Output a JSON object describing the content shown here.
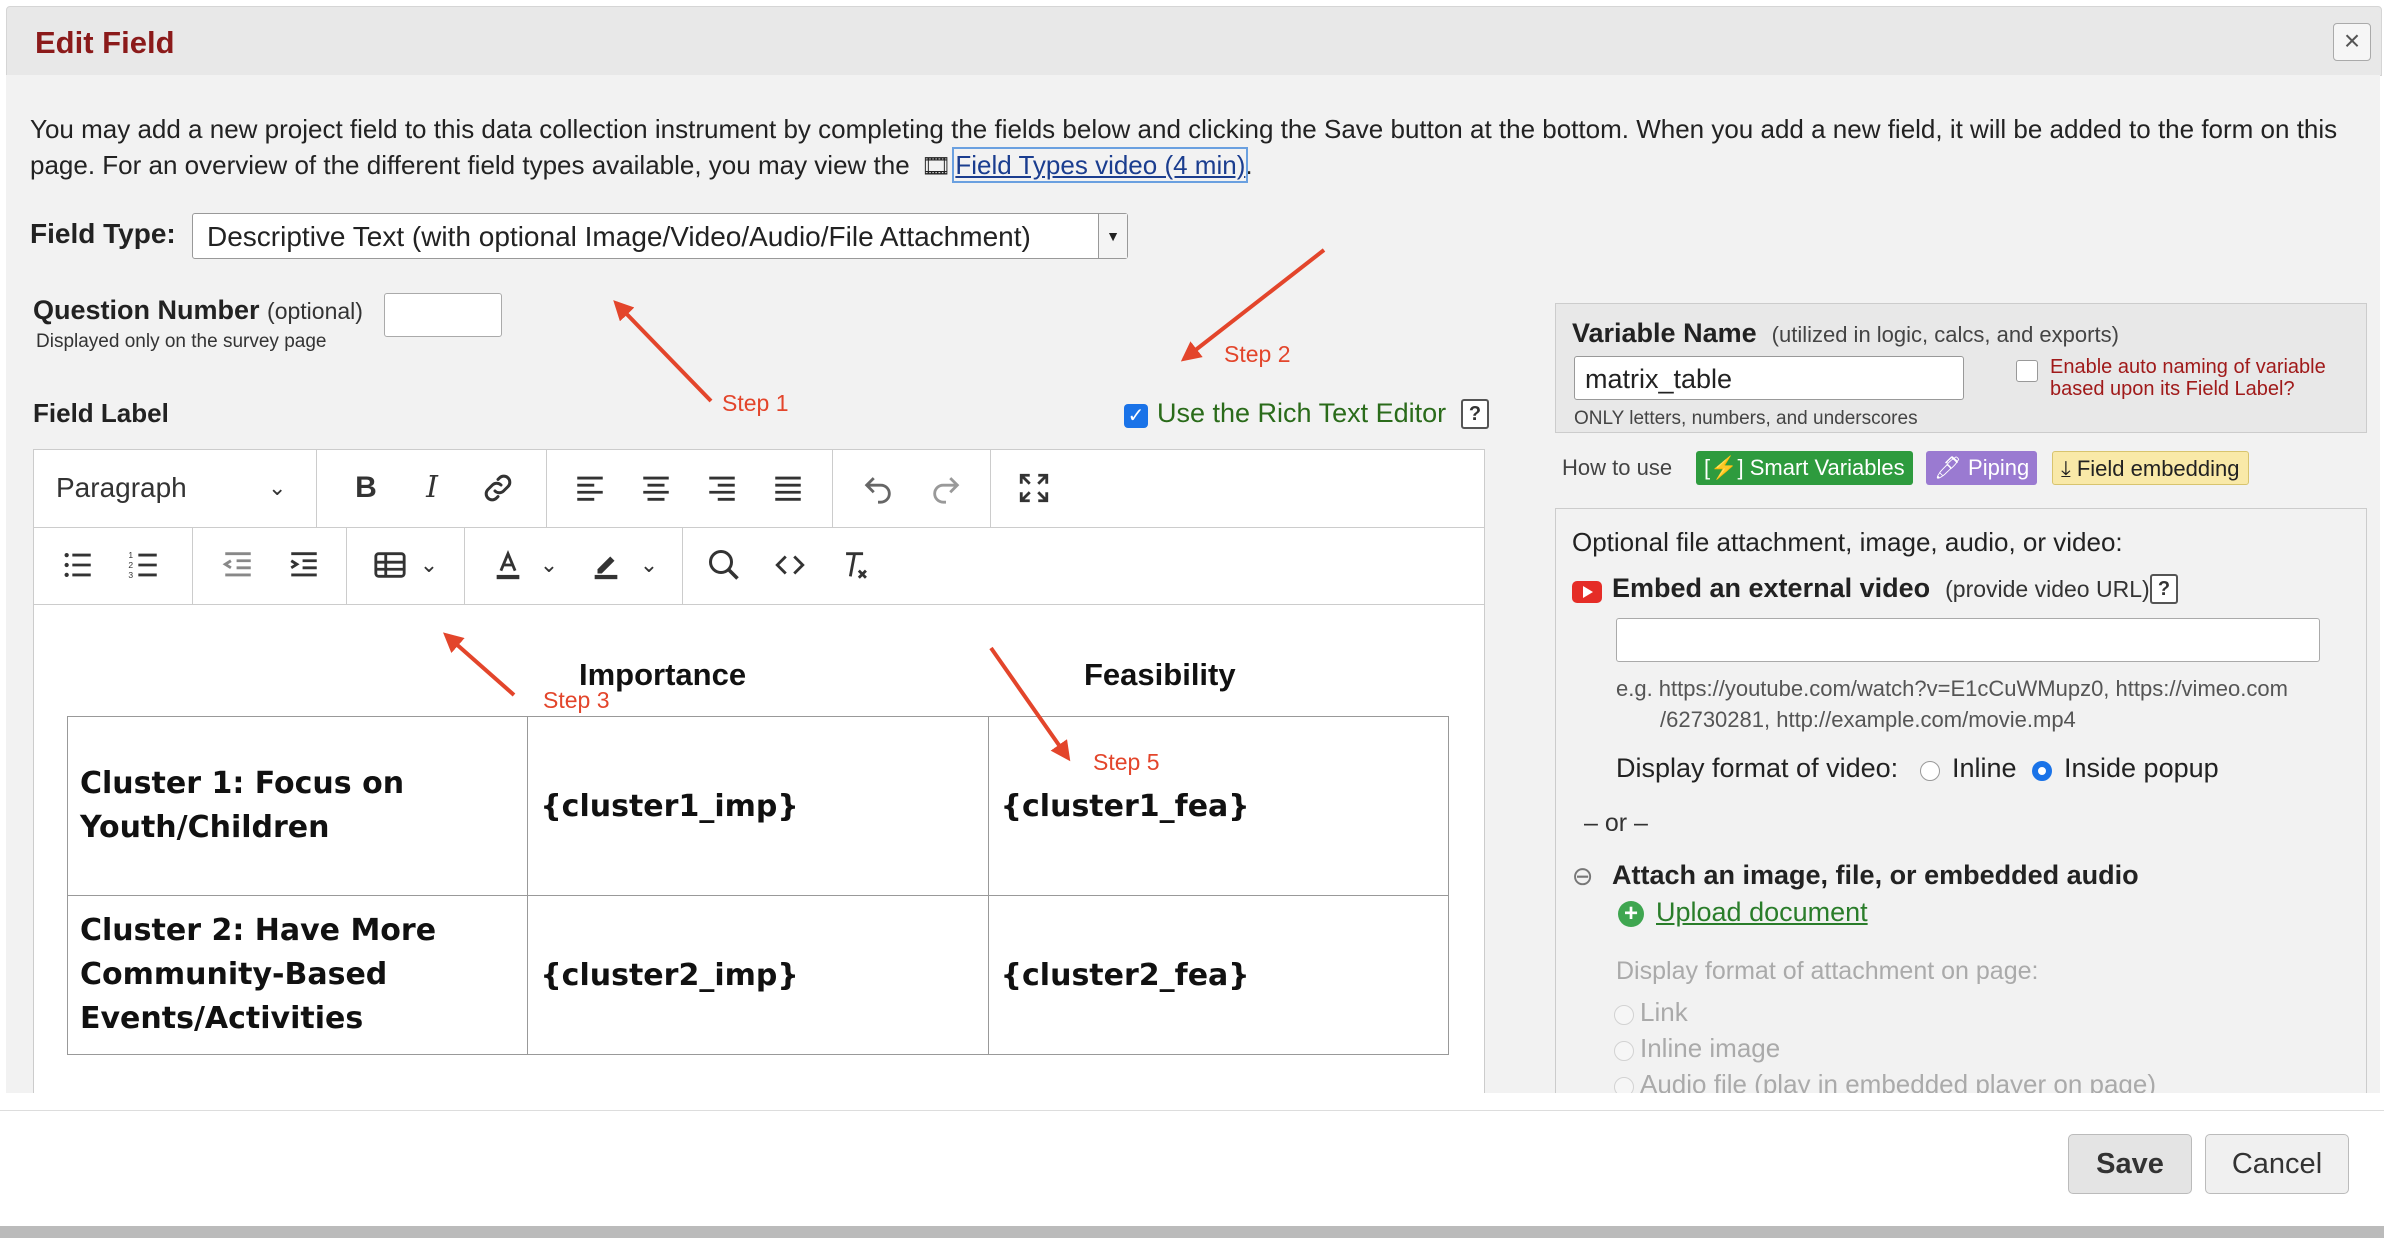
{
  "dialog": {
    "title": "Edit Field",
    "close_glyph": "×"
  },
  "intro": {
    "text": "You may add a new project field to this data collection instrument by completing the fields below and clicking the Save button at the bottom. When you add a new field, it will be added to the form on this page. For an overview of the different field types available, you may view the",
    "film_glyph": "🎞",
    "link": "Field Types video (4 min)",
    "after_link": "."
  },
  "field_type": {
    "label": "Field Type:",
    "value": "Descriptive Text (with optional Image/Video/Audio/File Attachment)"
  },
  "question_number": {
    "label": "Question Number",
    "optional": "(optional)",
    "sub": "Displayed only on the survey page"
  },
  "field_label": {
    "label": "Field Label",
    "rte_label": "Use the Rich Text Editor",
    "help": "?"
  },
  "toolbar": {
    "block_format": "Paragraph"
  },
  "matrix": {
    "col_headers": [
      "Importance",
      "Feasibility"
    ],
    "rows": [
      {
        "label": "Cluster 1: Focus on Youth/Children",
        "imp": "{cluster1_imp}",
        "fea": "{cluster1_fea}"
      },
      {
        "label_bold": "Cluster 2:",
        "label_rest": " Have More Community-Based Events/Activities",
        "imp": "{cluster2_imp}",
        "fea": "{cluster2_fea}"
      }
    ]
  },
  "annotations": {
    "step1": "Step 1",
    "step2": "Step 2",
    "step3": "Step 3",
    "step5": "Step 5",
    "color": "#e3452b"
  },
  "variable": {
    "label": "Variable Name",
    "hint": "(utilized in logic, calcs, and exports)",
    "value": "matrix_table",
    "sub": "ONLY letters, numbers, and underscores",
    "auto_label": "Enable auto naming of variable based upon its Field Label?"
  },
  "howto": {
    "label": "How to use",
    "smart": "[⚡] Smart Variables",
    "piping": "🖊 Piping",
    "embedding": "⤓ Field embedding"
  },
  "attachment": {
    "heading": "Optional file attachment, image, audio, or video:",
    "embed_label": "Embed an external video",
    "embed_hint": "(provide video URL)",
    "help": "?",
    "eg_line1": "e.g. https://youtube.com/watch?v=E1cCuWMupz0, https://vimeo.com",
    "eg_line2": "/62730281, http://example.com/movie.mp4",
    "display_label": "Display format of video:",
    "opt_inline": "Inline",
    "opt_popup": "Inside popup",
    "or": "– or –",
    "attach_label": "Attach an image, file, or embedded audio",
    "upload": "Upload document",
    "fmt_label": "Display format of attachment on page:",
    "fmt_link": "Link",
    "fmt_inline_img": "Inline image",
    "fmt_audio": "Audio file (play in embedded player on page)"
  },
  "footer": {
    "save": "Save",
    "cancel": "Cancel"
  }
}
